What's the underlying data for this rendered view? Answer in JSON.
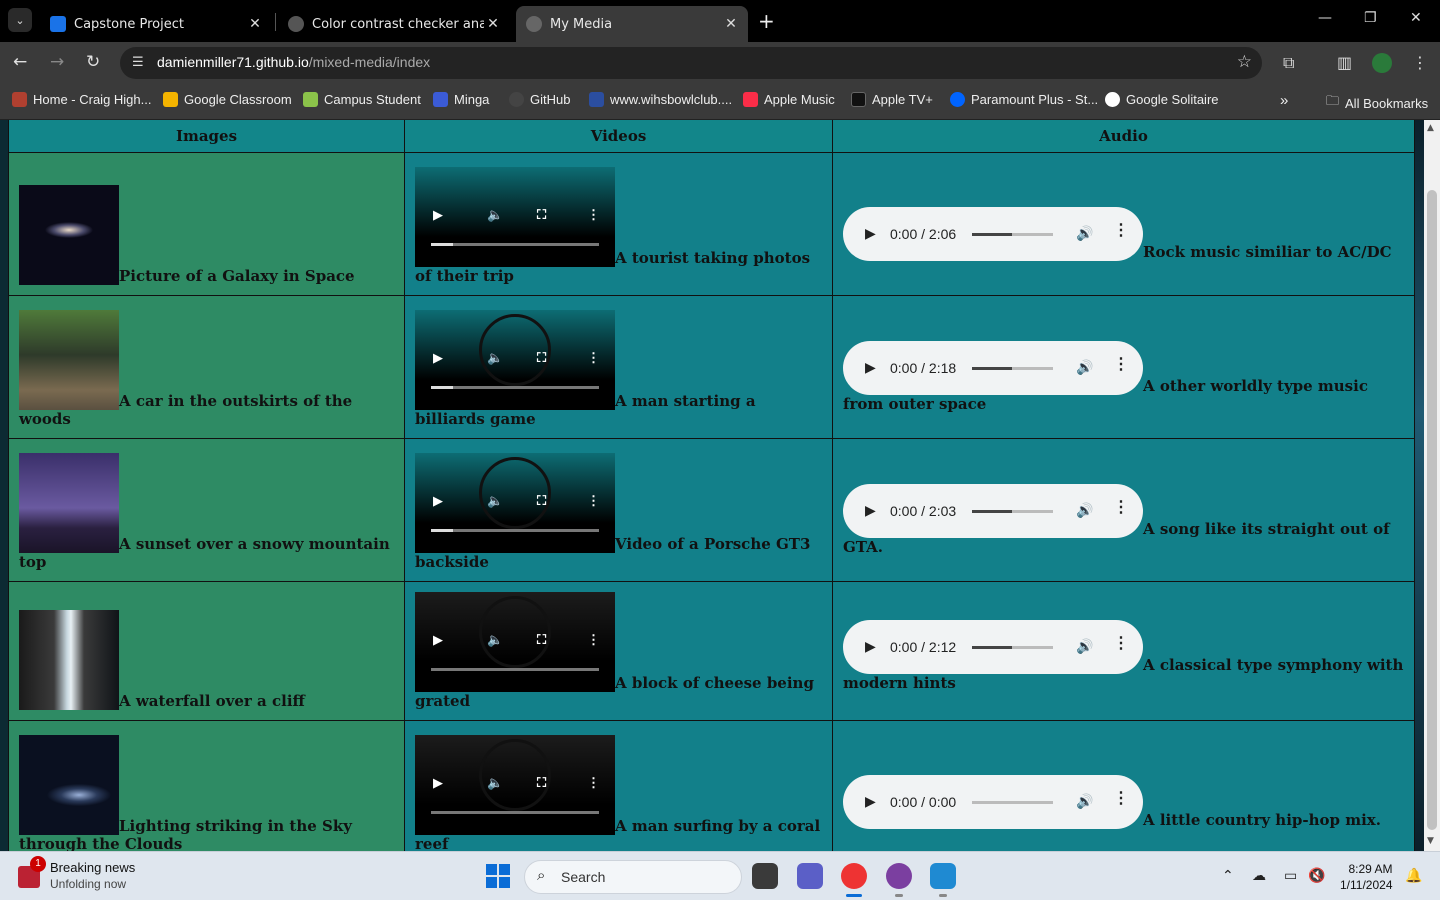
{
  "browser": {
    "tabs": [
      {
        "title": "Capstone Project",
        "active": false
      },
      {
        "title": "Color contrast checker analyzer",
        "active": false
      },
      {
        "title": "My Media",
        "active": true
      }
    ],
    "url_domain": "damienmiller71.github.io",
    "url_path": "/mixed-media/index",
    "bookmarks": [
      {
        "label": "Home - Craig High...",
        "color": "#b04030"
      },
      {
        "label": "Google Classroom",
        "color": "#f4b400"
      },
      {
        "label": "Campus Student",
        "color": "#8bc34a"
      },
      {
        "label": "Minga",
        "color": "#3b5bd6"
      },
      {
        "label": "GitHub",
        "color": "#444444"
      },
      {
        "label": "www.wihsbowlclub....",
        "color": "#2b4ea0"
      },
      {
        "label": "Apple Music",
        "color": "#fa2d48"
      },
      {
        "label": "Apple TV+",
        "color": "#111111"
      },
      {
        "label": "Paramount Plus - St...",
        "color": "#0064ff"
      },
      {
        "label": "Google Solitaire",
        "color": "#ffffff"
      }
    ],
    "all_bookmarks": "All Bookmarks"
  },
  "table": {
    "headers": {
      "images": "Images",
      "videos": "Videos",
      "audio": "Audio"
    },
    "rows": [
      {
        "image_caption": "Picture of a Galaxy in Space",
        "image_icon": "galaxy",
        "video_caption": "A tourist taking photos of their trip",
        "audio_caption": "Rock music similiar to AC/DC",
        "audio_time": "0:00 / 2:06",
        "audio_progress": 0.5
      },
      {
        "image_caption": "A car in the outskirts of the woods",
        "image_icon": "jeep-in-woods",
        "video_caption": "A man starting a billiards game",
        "audio_caption": "A other worldly type music from outer space",
        "audio_time": "0:00 / 2:18",
        "audio_progress": 0.5
      },
      {
        "image_caption": "A sunset over a snowy mountain top",
        "image_icon": "mountain-night",
        "video_caption": "Video of a Porsche GT3 backside",
        "audio_caption": "A song like its straight out of GTA.",
        "audio_time": "0:00 / 2:03",
        "audio_progress": 0.5
      },
      {
        "image_caption": "A waterfall over a cliff",
        "image_icon": "waterfall",
        "video_caption": "A block of cheese being grated",
        "audio_caption": "A classical type symphony with modern hints",
        "audio_time": "0:00 / 2:12",
        "audio_progress": 0.5
      },
      {
        "image_caption": "Lighting striking in the Sky through the Clouds",
        "image_icon": "lightning",
        "video_caption": "A man surfing by a coral reef",
        "audio_caption": "A little country hip-hop mix.",
        "audio_time": "0:00 / 0:00",
        "audio_progress": 0.0
      }
    ]
  },
  "taskbar": {
    "news_title": "Breaking news",
    "news_subtitle": "Unfolding now",
    "news_badge": "1",
    "search_label": "Search",
    "time": "8:29 AM",
    "date": "1/11/2024"
  }
}
